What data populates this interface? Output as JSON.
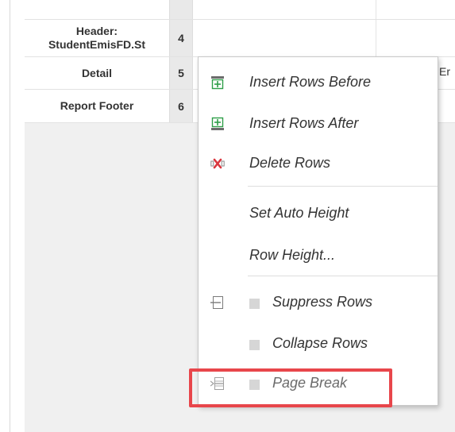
{
  "grid": {
    "rows": [
      {
        "label": "Header:\nStudentEmisFD.St",
        "number": "4"
      },
      {
        "label": "Detail",
        "number": "5"
      },
      {
        "label": "Report Footer",
        "number": "6"
      }
    ],
    "truncated_cell_text": "Er"
  },
  "context_menu": {
    "items": [
      {
        "label": "Insert Rows Before",
        "icon": "insert-rows-before-icon"
      },
      {
        "label": "Insert Rows After",
        "icon": "insert-rows-after-icon"
      },
      {
        "label": "Delete Rows",
        "icon": "delete-rows-icon"
      },
      {
        "label": "Set Auto Height"
      },
      {
        "label": "Row Height..."
      },
      {
        "label": "Suppress Rows",
        "icon": "suppress-rows-icon",
        "checked": false
      },
      {
        "label": "Collapse Rows",
        "checked": false
      },
      {
        "label": "Page Break",
        "icon": "page-break-icon",
        "checked": false,
        "disabled": true
      }
    ]
  },
  "colors": {
    "highlight": "#e8464b",
    "insert_icon": "#2e9e48",
    "delete_icon": "#d9363e"
  }
}
